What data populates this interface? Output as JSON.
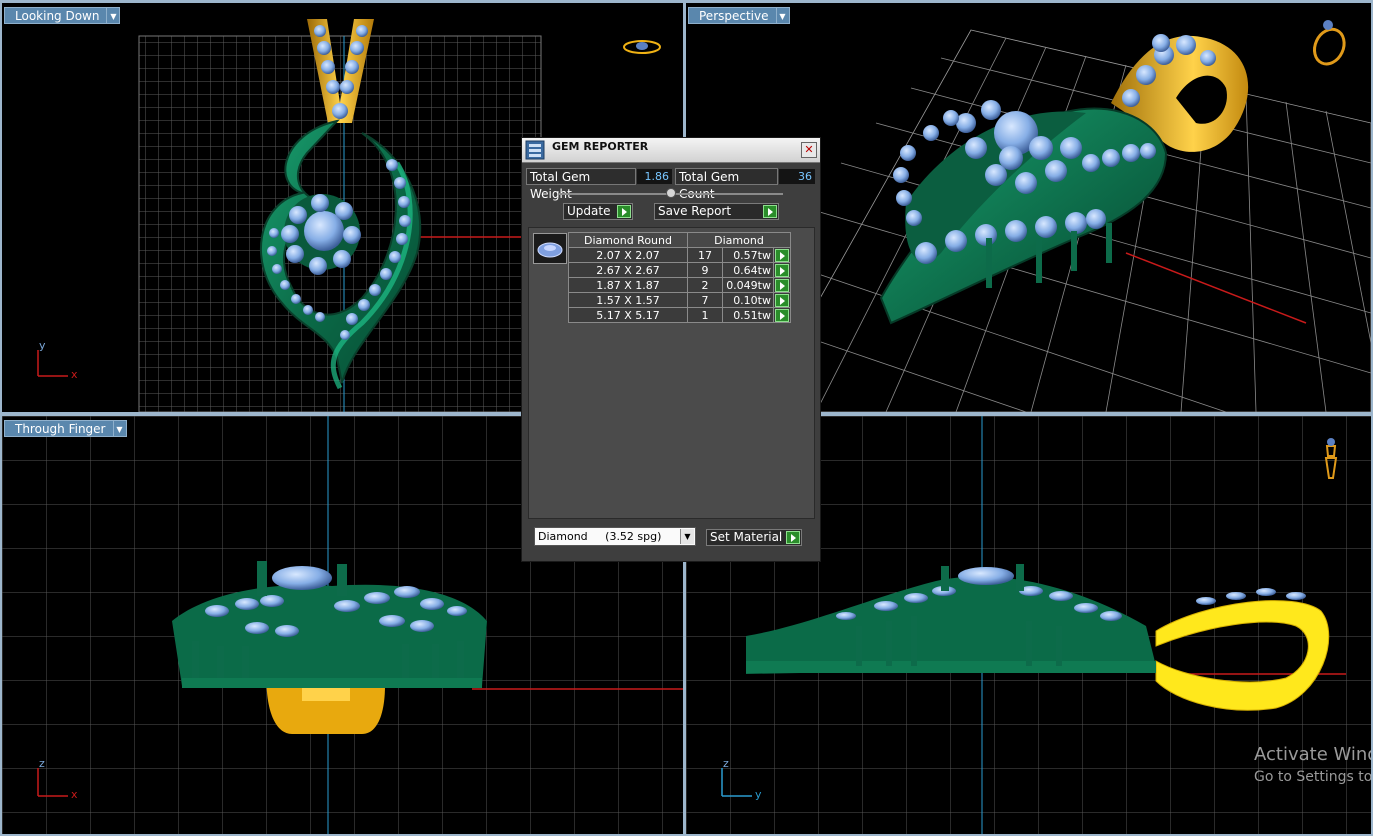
{
  "viewports": {
    "top_left": {
      "label": "Looking Down"
    },
    "top_right": {
      "label": "Perspective"
    },
    "bottom_left": {
      "label": "Through Finger"
    }
  },
  "axes": {
    "top_left": {
      "vertical": "y",
      "horizontal": "x"
    },
    "bottom_left": {
      "vertical": "z",
      "horizontal": "x"
    },
    "bottom_right": {
      "vertical": "z",
      "horizontal": "y"
    }
  },
  "gem_reporter": {
    "title": "GEM REPORTER",
    "total_weight_label": "Total Gem Weight",
    "total_weight_value": "1.86",
    "total_count_label": "Total Gem Count",
    "total_count_value": "36",
    "update_label": "Update",
    "save_report_label": "Save Report",
    "table_header_shape": "Diamond Round",
    "table_header_material": "Diamond",
    "rows": [
      {
        "size": "2.07 X 2.07",
        "count": "17",
        "weight": "0.57tw"
      },
      {
        "size": "2.67 X 2.67",
        "count": "9",
        "weight": "0.64tw"
      },
      {
        "size": "1.87 X 1.87",
        "count": "2",
        "weight": "0.049tw"
      },
      {
        "size": "1.57 X 1.57",
        "count": "7",
        "weight": "0.10tw"
      },
      {
        "size": "5.17 X 5.17",
        "count": "1",
        "weight": "0.51tw"
      }
    ],
    "material_value": "Diamond     (3.52 spg)",
    "set_material_label": "Set Material"
  },
  "watermark": {
    "line1": "Activate Wind",
    "line2": "Go to Settings to a"
  },
  "colors": {
    "metal_green": "#0d6b4a",
    "metal_gold": "#f0b214",
    "gem_blue": "#8ab4ea",
    "grid": "#5a5a5a",
    "button_green": "#2a8d2a"
  }
}
